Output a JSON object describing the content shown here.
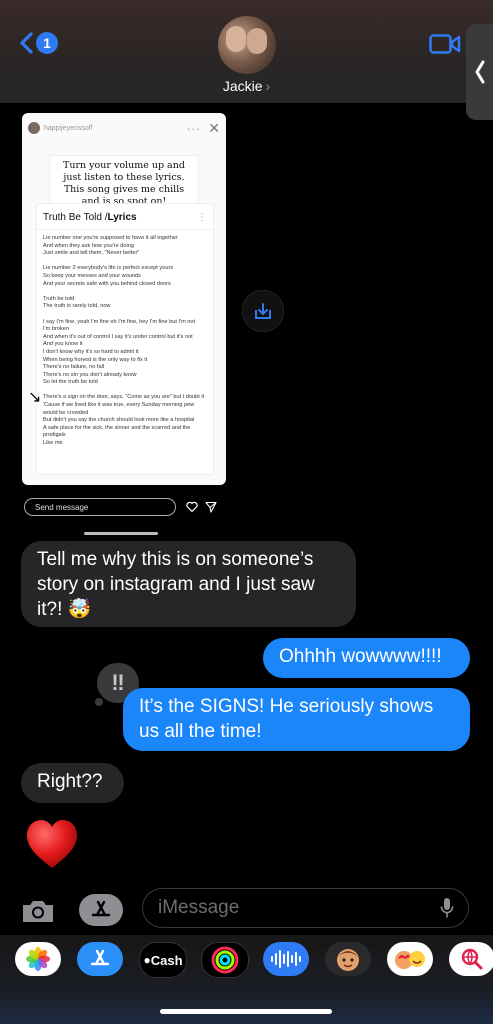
{
  "header": {
    "back_badge": "1",
    "contact_name": "Jackie",
    "contact_chevron": "›"
  },
  "story": {
    "username": "happijeyerissoff",
    "quote": "Turn your volume up and just listen to these lyrics. This song gives me chills and is so spot on!",
    "lyrics_title_prefix": "Truth Be Told / ",
    "lyrics_title_bold": "Lyrics",
    "lyrics_text": "Lie number one you're supposed to have it all together\nAnd when they ask how you're doing\nJust smile and tell them, \"Never better\"\n\nLie number 2 everybody's life is perfect except yours\nSo keep your messes and your wounds\nAnd your secrets safe with you behind closed doors\n\nTruth be told\nThe truth is rarely told, now\n\nI say I'm fine, yeah I'm fine oh I'm fine, hey I'm fine but I'm not\nI'm broken\nAnd when it's out of control I say it's under control but it's not\nAnd you know it\nI don't know why it's so hard to admit it\nWhen being honest is the only way to fix it\nThere's no failure, no fall\nThere's no sin you don't already know\nSo let the truth be told\n\nThere's a sign on the door, says, \"Come as you are\" but I doubt it\n'Cause if we lived like it was true, every Sunday morning pew would be crowded\nBut didn't you say the church should look more like a hospital\nA safe place for the sick, the sinner and the scarred and the prodigals\nLike me",
    "send_message": "Send message"
  },
  "messages": [
    {
      "side": "left",
      "text": "Tell me why this is on someone’s story on instagram and I just saw it?! 🤯"
    },
    {
      "side": "right",
      "text": "Ohhhh wowwww!!!!"
    },
    {
      "side": "right",
      "text": "It’s the SIGNS! He seriously shows us all the time!"
    },
    {
      "side": "left",
      "text": "Right??"
    }
  ],
  "reaction": "‼",
  "input": {
    "placeholder": "iMessage"
  },
  "tray": {
    "apps": [
      "photos-icon",
      "app-store-icon",
      "apple-cash-icon",
      "activity-icon",
      "audio-message-icon",
      "memoji-icon",
      "memoji-stickers-icon",
      "web-search-icon"
    ],
    "cash_label": "Cash"
  },
  "colors": {
    "blue_bubble": "#1b86f9",
    "gray_bubble": "#262628",
    "accent": "#2f7bf6"
  }
}
